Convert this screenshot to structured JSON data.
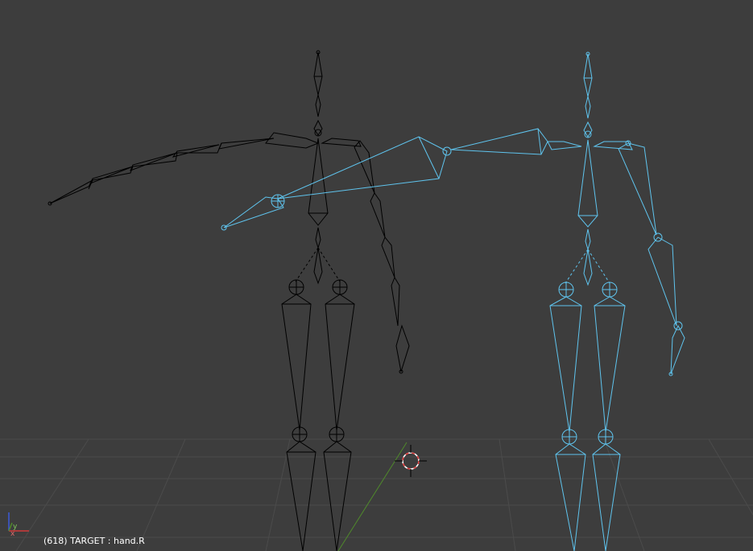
{
  "app": "Blender 3D Viewport",
  "status": {
    "frame": "(618)",
    "text": "(618) TARGET : hand.R"
  },
  "axis_gizmo": {
    "x_label": "x",
    "y_label": "y"
  },
  "colors": {
    "background": "#3d3d3d",
    "grid": "#4d4d4d",
    "y_axis": "#4f8a2b",
    "unselected_armature": "#000000",
    "selected_armature": "#5fc4ee",
    "cursor_red": "#e03a3a"
  },
  "scene": {
    "armatures": [
      {
        "name": "armature-unselected",
        "state": "unselected"
      },
      {
        "name": "armature-selected",
        "state": "selected",
        "active_bone": "hand.R"
      }
    ]
  }
}
